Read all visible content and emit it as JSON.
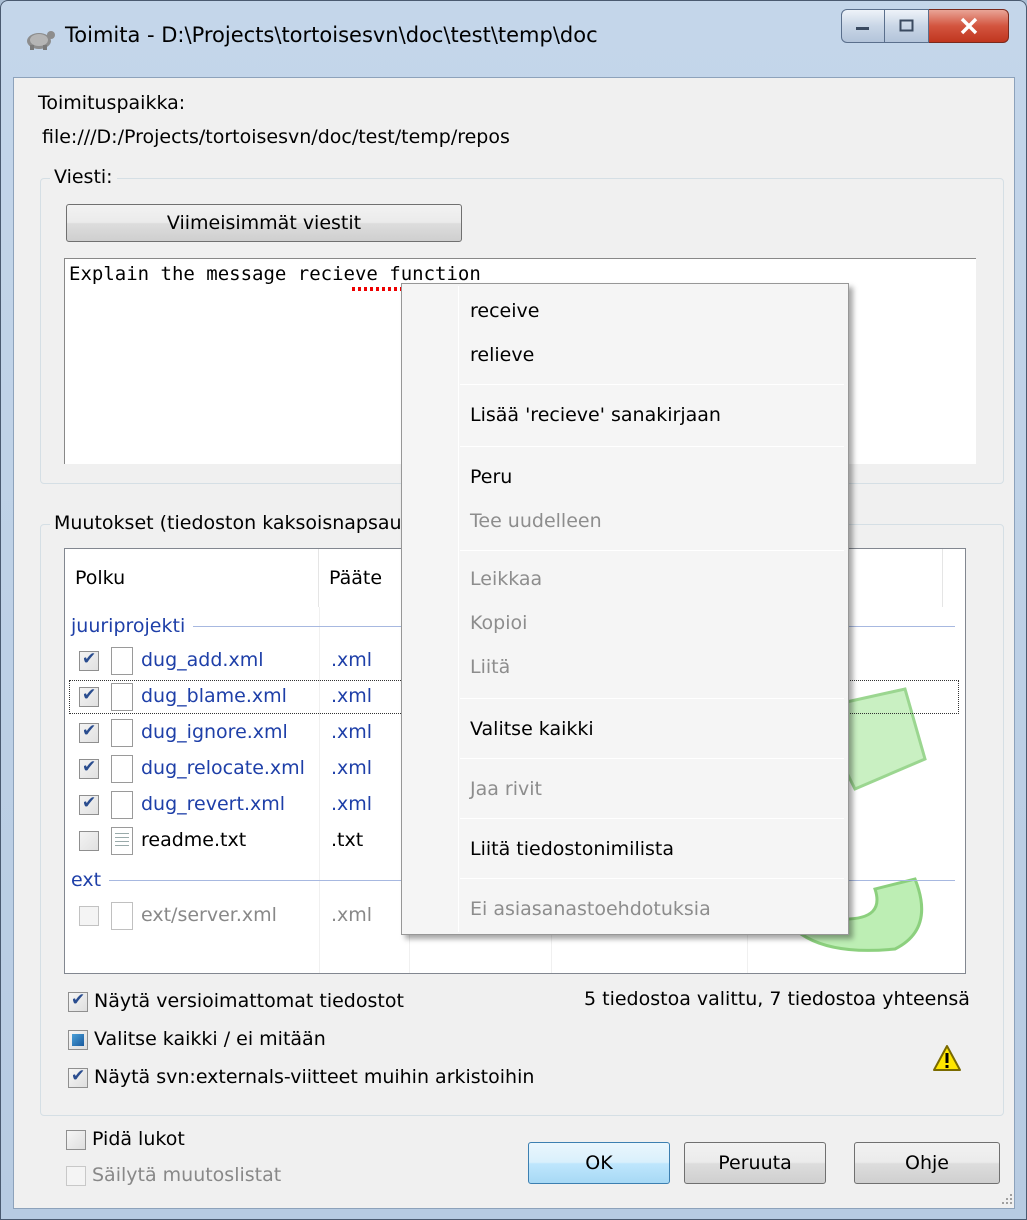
{
  "window": {
    "title": "Toimita - D:\\Projects\\tortoisesvn\\doc\\test\\temp\\doc"
  },
  "commit_to": {
    "label": "Toimituspaikka:",
    "url": "file:///D:/Projects/tortoisesvn/doc/test/temp/repos"
  },
  "message": {
    "group_label": "Viesti:",
    "recent_button": "Viimeisimmät viestit",
    "text": "Explain the message recieve function"
  },
  "changes": {
    "group_label": "Muutokset (tiedoston kaksoisnapsau",
    "columns": [
      "Polku",
      "Pääte"
    ],
    "groups": [
      {
        "name": "juuriprojekti",
        "files": [
          {
            "name": "dug_add.xml",
            "ext": ".xml",
            "checked": true
          },
          {
            "name": "dug_blame.xml",
            "ext": ".xml",
            "checked": true
          },
          {
            "name": "dug_ignore.xml",
            "ext": ".xml",
            "checked": true
          },
          {
            "name": "dug_relocate.xml",
            "ext": ".xml",
            "checked": true
          },
          {
            "name": "dug_revert.xml",
            "ext": ".xml",
            "checked": true
          },
          {
            "name": "readme.txt",
            "ext": ".txt",
            "checked": false
          }
        ]
      },
      {
        "name": "ext",
        "files": [
          {
            "name": "ext/server.xml",
            "ext": ".xml",
            "checked": false
          }
        ]
      }
    ],
    "summary": "5 tiedostoa valittu, 7 tiedostoa yhteensä",
    "show_unversioned": "Näytä versioimattomat tiedostot",
    "select_all": "Valitse kaikki / ei mitään",
    "show_externals": "Näytä svn:externals-viitteet muihin arkistoihin"
  },
  "options": {
    "keep_locks": "Pidä lukot",
    "keep_changelists": "Säilytä muutoslistat"
  },
  "buttons": {
    "ok": "OK",
    "cancel": "Peruuta",
    "help": "Ohje"
  },
  "context_menu": {
    "suggestion_1": "receive",
    "suggestion_2": "relieve",
    "add_to_dict": "Lisää 'recieve' sanakirjaan",
    "undo": "Peru",
    "redo": "Tee uudelleen",
    "cut": "Leikkaa",
    "copy": "Kopioi",
    "paste": "Liitä",
    "select_all": "Valitse kaikki",
    "split_lines": "Jaa rivit",
    "paste_filenames": "Liitä tiedostonimilista",
    "no_thesaurus": "Ei asiasanastoehdotuksia"
  },
  "colors": {
    "link_blue": "#1e3fa8",
    "disabled_gray": "#8d8d8d"
  }
}
